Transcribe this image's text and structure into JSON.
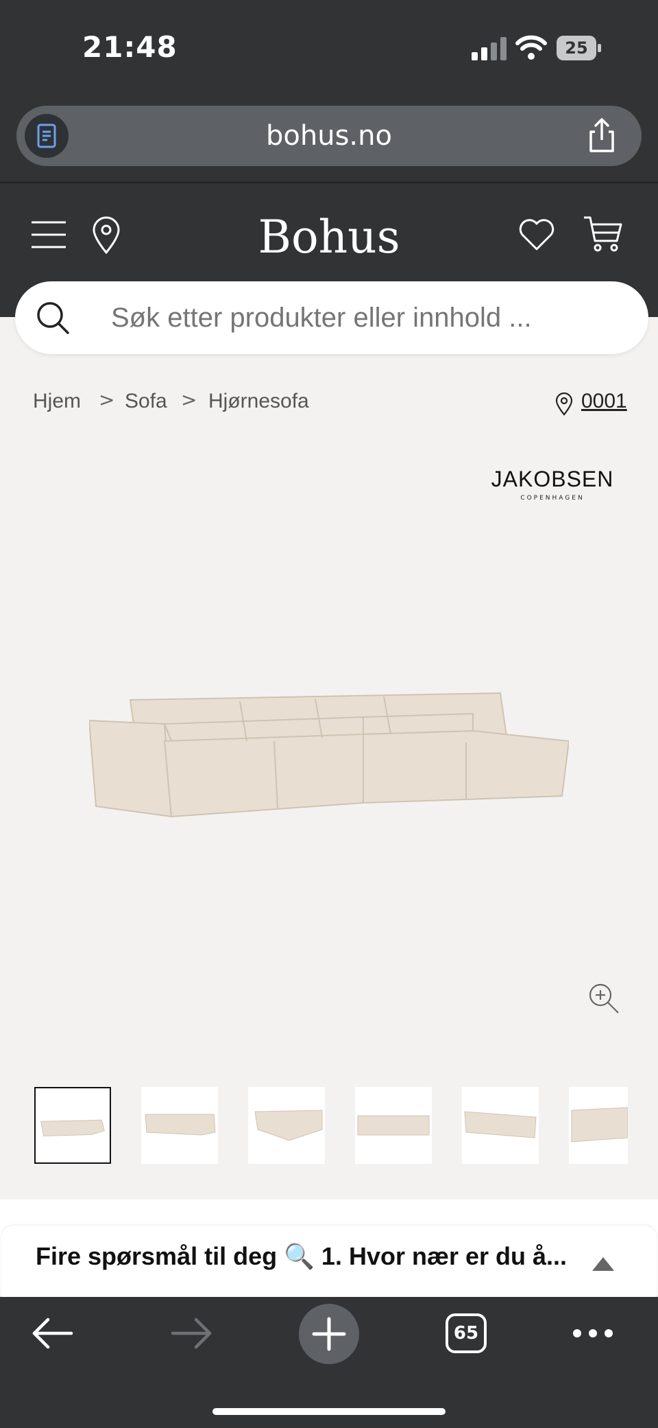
{
  "status_bar": {
    "time": "21:48",
    "battery": "25"
  },
  "browser": {
    "url": "bohus.no",
    "open_tabs": "65"
  },
  "header": {
    "logo": "Bohus"
  },
  "search": {
    "placeholder": "Søk etter produkter eller innhold ..."
  },
  "breadcrumbs": [
    {
      "label": "Hjem"
    },
    {
      "label": "Sofa"
    },
    {
      "label": "Hjørnesofa"
    }
  ],
  "breadcrumb_separator": ">",
  "store": {
    "code": "0001"
  },
  "brand": {
    "name": "JAKOBSEN",
    "subtitle": "COPENHAGEN"
  },
  "chat": {
    "text": "Fire spørsmål til deg 🔍 1. Hvor nær er du å..."
  },
  "colors": {
    "chrome": "#313335",
    "url_bar": "#5e6267",
    "page_bg": "#f4f2f0",
    "sofa": "#e6ddd0"
  },
  "icons": [
    "reader-icon",
    "share-icon",
    "menu-icon",
    "location-pin-icon",
    "heart-icon",
    "cart-icon",
    "search-icon",
    "zoom-in-icon",
    "back-arrow-icon",
    "forward-arrow-icon",
    "plus-icon",
    "tabs-icon",
    "more-icon"
  ]
}
